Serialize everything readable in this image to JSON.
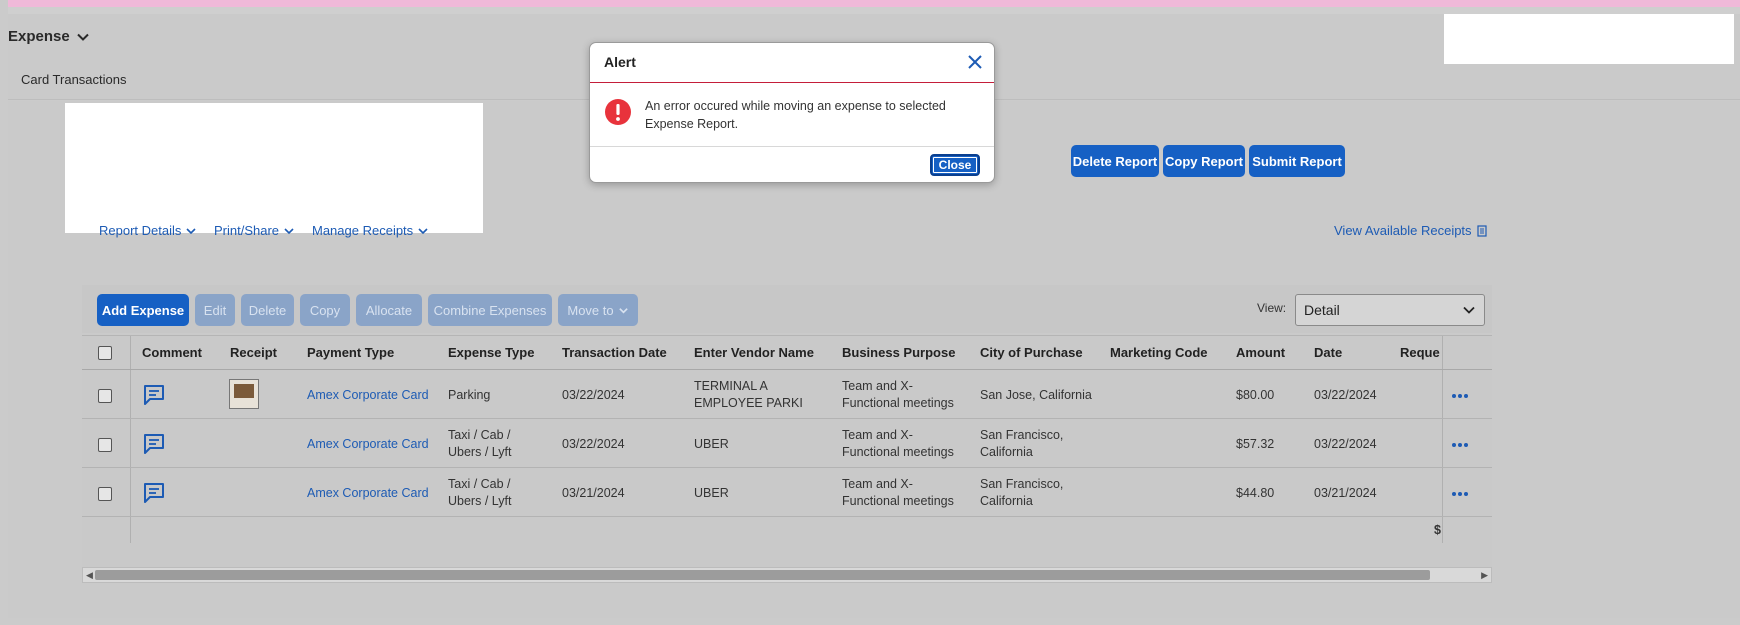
{
  "header": {
    "app_title": "Expense",
    "subnav_item": "Card Transactions"
  },
  "report_actions": {
    "delete_label": "Delete Report",
    "copy_label": "Copy Report",
    "submit_label": "Submit Report"
  },
  "report_menus": {
    "details": "Report Details",
    "print_share": "Print/Share",
    "manage_receipts": "Manage Receipts",
    "view_receipts": "View Available Receipts"
  },
  "toolbar": {
    "add_expense": "Add Expense",
    "edit": "Edit",
    "delete": "Delete",
    "copy": "Copy",
    "allocate": "Allocate",
    "combine": "Combine Expenses",
    "move_to": "Move to",
    "view_label": "View:",
    "view_value": "Detail"
  },
  "table": {
    "columns": [
      "Comment",
      "Receipt",
      "Payment Type",
      "Expense Type",
      "Transaction Date",
      "Enter Vendor Name",
      "Business Purpose",
      "City of Purchase",
      "Marketing Code",
      "Amount",
      "Date",
      "Reque"
    ],
    "rows": [
      {
        "payment_type": "Amex Corporate Card",
        "expense_type": "Parking",
        "transaction_date": "03/22/2024",
        "vendor": "TERMINAL A EMPLOYEE PARKI",
        "purpose": "Team and X-Functional meetings",
        "city": "San Jose, California",
        "marketing_code": "",
        "amount": "$80.00",
        "date": "03/22/2024"
      },
      {
        "payment_type": "Amex Corporate Card",
        "expense_type": "Taxi / Cab / Ubers / Lyft",
        "transaction_date": "03/22/2024",
        "vendor": "UBER",
        "purpose": "Team and X-Functional meetings",
        "city": "San Francisco, California",
        "marketing_code": "",
        "amount": "$57.32",
        "date": "03/22/2024"
      },
      {
        "payment_type": "Amex Corporate Card",
        "expense_type": "Taxi / Cab / Ubers / Lyft",
        "transaction_date": "03/21/2024",
        "vendor": "UBER",
        "purpose": "Team and X-Functional meetings",
        "city": "San Francisco, California",
        "marketing_code": "",
        "amount": "$44.80",
        "date": "03/21/2024"
      }
    ],
    "footer_partial": "$"
  },
  "modal": {
    "title": "Alert",
    "message": "An error occured while moving an expense to selected Expense Report.",
    "close_label": "Close"
  },
  "colors": {
    "primary": "#1660c4",
    "link": "#1d5bb4",
    "error": "#e8333c"
  }
}
